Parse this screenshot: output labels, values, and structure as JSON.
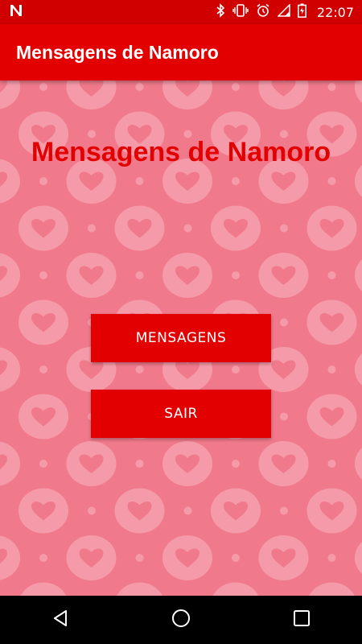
{
  "status_bar": {
    "time": "22:07",
    "icons": [
      "n-notification-icon",
      "bluetooth-icon",
      "vibrate-icon",
      "alarm-icon",
      "signal-icon",
      "battery-charging-icon"
    ]
  },
  "app_bar": {
    "title": "Mensagens de Namoro"
  },
  "main": {
    "heading": "Mensagens de Namoro",
    "buttons": {
      "mensagens": "MENSAGENS",
      "sair": "SAIR"
    }
  },
  "nav_bar": {
    "icons": [
      "back-icon",
      "home-icon",
      "recents-icon"
    ]
  },
  "colors": {
    "primary": "#e30000",
    "status_bar": "#d10000",
    "background": "#f07a8c",
    "pattern_light": "#f59aa8"
  }
}
